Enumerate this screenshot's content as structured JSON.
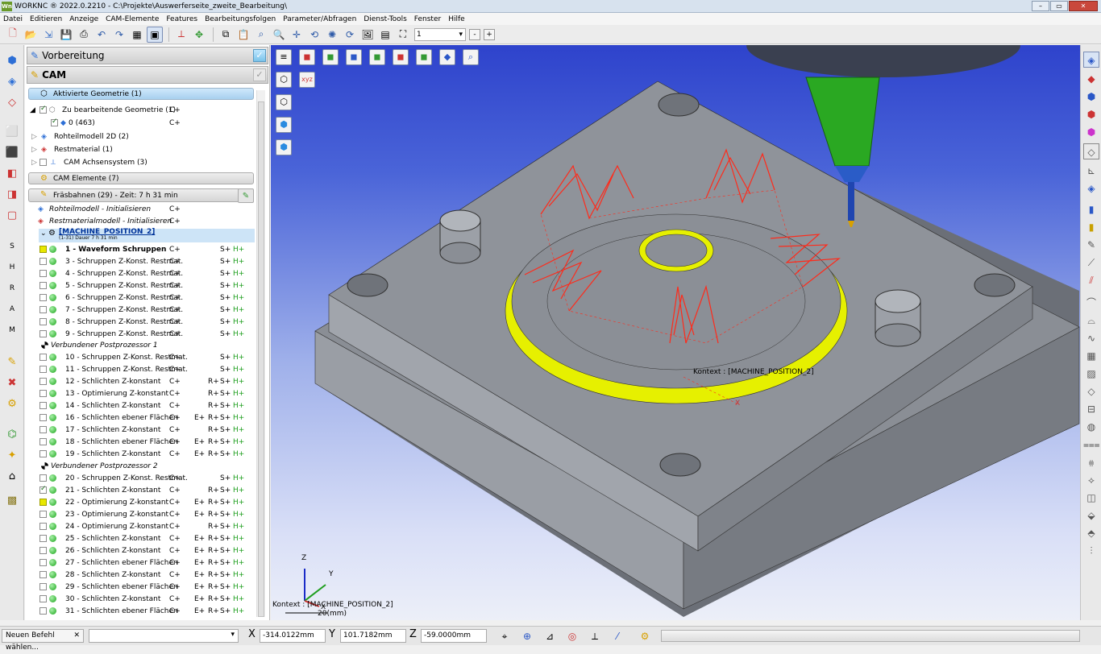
{
  "window": {
    "logo": "Wn",
    "title": "WORKNC ® 2022.0.2210 - C:\\Projekte\\Auswerferseite_zweite_Bearbeitung\\",
    "controls": [
      "–",
      "▭",
      "✕"
    ]
  },
  "menu": [
    "Datei",
    "Editieren",
    "Anzeige",
    "CAM-Elemente",
    "Features",
    "Bearbeitungsfolgen",
    "Parameter/Abfragen",
    "Dienst-Tools",
    "Fenster",
    "Hilfe"
  ],
  "toolbar": {
    "layer_value": "1",
    "minus": "-",
    "plus": "+"
  },
  "panel": {
    "header1": "Vorbereitung",
    "header2": "CAM",
    "group_active": "Aktivierte Geometrie (1)",
    "tree": [
      {
        "label": "Zu bearbeitende Geometrie (1)",
        "col": "C+"
      },
      {
        "label": "0 (463)",
        "col": "C+"
      },
      {
        "label": "Rohteilmodell 2D (2)",
        "col": ""
      },
      {
        "label": "Restmaterial (1)",
        "col": ""
      },
      {
        "label": "CAM Achsensystem (3)",
        "col": ""
      }
    ],
    "group_cam": "CAM Elemente (7)",
    "group_toolpaths": "Fräsbahnen (29) - Zeit: 7 h 31 min",
    "init_rows": [
      {
        "label": "Rohteilmodell - Initialisieren",
        "col": "C+"
      },
      {
        "label": "Restmaterialmodell - Initialisieren",
        "col": "C+"
      }
    ],
    "machine": {
      "label": "[MACHINE_POSITION_2]",
      "sub": "(1-31) Dauer 7 h 31 min"
    },
    "post1": "Verbundener Postprozessor 1",
    "post2": "Verbundener Postprozessor 2",
    "rows_a": [
      {
        "label": "1 - Waveform Schruppen",
        "c": "C+",
        "e": "",
        "r": "",
        "s": "S+",
        "h": "H+",
        "cb": "yellow",
        "bold": true
      },
      {
        "label": "3 - Schruppen Z-Konst. Restmat.",
        "c": "C+",
        "e": "",
        "r": "",
        "s": "S+",
        "h": "H+",
        "cb": ""
      },
      {
        "label": "4 - Schruppen Z-Konst. Restmat.",
        "c": "C+",
        "e": "",
        "r": "",
        "s": "S+",
        "h": "H+",
        "cb": ""
      },
      {
        "label": "5 - Schruppen Z-Konst. Restmat.",
        "c": "C+",
        "e": "",
        "r": "",
        "s": "S+",
        "h": "H+",
        "cb": ""
      },
      {
        "label": "6 - Schruppen Z-Konst. Restmat.",
        "c": "C+",
        "e": "",
        "r": "",
        "s": "S+",
        "h": "H+",
        "cb": ""
      },
      {
        "label": "7 - Schruppen Z-Konst. Restmat.",
        "c": "C+",
        "e": "",
        "r": "",
        "s": "S+",
        "h": "H+",
        "cb": ""
      },
      {
        "label": "8 - Schruppen Z-Konst. Restmat.",
        "c": "C+",
        "e": "",
        "r": "",
        "s": "S+",
        "h": "H+",
        "cb": ""
      },
      {
        "label": "9 - Schruppen Z-Konst. Restmat.",
        "c": "C+",
        "e": "",
        "r": "",
        "s": "S+",
        "h": "H+",
        "cb": ""
      }
    ],
    "rows_b": [
      {
        "label": "10 - Schruppen Z-Konst. Restmat.",
        "c": "C+",
        "e": "",
        "r": "",
        "s": "S+",
        "h": "H+",
        "cb": ""
      },
      {
        "label": "11 - Schruppen Z-Konst. Restmat.",
        "c": "C+",
        "e": "",
        "r": "",
        "s": "S+",
        "h": "H+",
        "cb": ""
      },
      {
        "label": "12 - Schlichten Z-konstant",
        "c": "C+",
        "e": "",
        "r": "R+",
        "s": "S+",
        "h": "H+",
        "cb": ""
      },
      {
        "label": "13 - Optimierung Z-konstant",
        "c": "C+",
        "e": "",
        "r": "R+",
        "s": "S+",
        "h": "H+",
        "cb": ""
      },
      {
        "label": "14 - Schlichten Z-konstant",
        "c": "C+",
        "e": "",
        "r": "R+",
        "s": "S+",
        "h": "H+",
        "cb": ""
      },
      {
        "label": "16 - Schlichten ebener Flächen",
        "c": "C+",
        "e": "E+",
        "r": "R+",
        "s": "S+",
        "h": "H+",
        "cb": ""
      },
      {
        "label": "17 - Schlichten Z-konstant",
        "c": "C+",
        "e": "",
        "r": "R+",
        "s": "S+",
        "h": "H+",
        "cb": ""
      },
      {
        "label": "18 - Schlichten ebener Flächen",
        "c": "C+",
        "e": "E+",
        "r": "R+",
        "s": "S+",
        "h": "H+",
        "cb": ""
      },
      {
        "label": "19 - Schlichten Z-konstant",
        "c": "C+",
        "e": "E+",
        "r": "R+",
        "s": "S+",
        "h": "H+",
        "cb": ""
      }
    ],
    "rows_c": [
      {
        "label": "20 - Schruppen Z-Konst. Restmat.",
        "c": "C+",
        "e": "",
        "r": "",
        "s": "S+",
        "h": "H+",
        "cb": ""
      },
      {
        "label": "21 - Schlichten Z-konstant",
        "c": "C+",
        "e": "",
        "r": "R+",
        "s": "S+",
        "h": "H+",
        "cb": "on"
      },
      {
        "label": "22 - Optimierung Z-konstant",
        "c": "C+",
        "e": "E+",
        "r": "R+",
        "s": "S+",
        "h": "H+",
        "cb": "yellow"
      },
      {
        "label": "23 - Optimierung Z-konstant",
        "c": "C+",
        "e": "E+",
        "r": "R+",
        "s": "S+",
        "h": "H+",
        "cb": ""
      },
      {
        "label": "24 - Optimierung Z-konstant",
        "c": "C+",
        "e": "",
        "r": "R+",
        "s": "S+",
        "h": "H+",
        "cb": ""
      },
      {
        "label": "25 - Schlichten Z-konstant",
        "c": "C+",
        "e": "E+",
        "r": "R+",
        "s": "S+",
        "h": "H+",
        "cb": ""
      },
      {
        "label": "26 - Schlichten Z-konstant",
        "c": "C+",
        "e": "E+",
        "r": "R+",
        "s": "S+",
        "h": "H+",
        "cb": ""
      },
      {
        "label": "27 - Schlichten ebener Flächen",
        "c": "C+",
        "e": "E+",
        "r": "R+",
        "s": "S+",
        "h": "H+",
        "cb": ""
      },
      {
        "label": "28 - Schlichten Z-konstant",
        "c": "C+",
        "e": "E+",
        "r": "R+",
        "s": "S+",
        "h": "H+",
        "cb": ""
      },
      {
        "label": "29 - Schlichten ebener Flächen",
        "c": "C+",
        "e": "E+",
        "r": "R+",
        "s": "S+",
        "h": "H+",
        "cb": ""
      },
      {
        "label": "30 - Schlichten Z-konstant",
        "c": "C+",
        "e": "E+",
        "r": "R+",
        "s": "S+",
        "h": "H+",
        "cb": ""
      },
      {
        "label": "31 - Schlichten ebener Flächen",
        "c": "C+",
        "e": "E+",
        "r": "R+",
        "s": "S+",
        "h": "H+",
        "cb": ""
      }
    ]
  },
  "viewport": {
    "context_label": "Kontext : [MACHINE_POSITION_2]",
    "context_label_bottom": "Kontext : [MACHINE_POSITION_2]",
    "scale_label": "20(mm)",
    "triad": {
      "x": "X",
      "y": "Y",
      "z": "Z"
    },
    "axis_x": "X",
    "colors": {
      "part": "#8d9197",
      "toolpath": "#ff2a1a",
      "ring": "#e6f000",
      "tool": "#2aa822",
      "background_top": "#2e43cc"
    }
  },
  "statusbar": {
    "command": "Neuen Befehl wählen...",
    "close": "✕",
    "x_label": "X",
    "x_value": "-314.0122mm",
    "y_label": "Y",
    "y_value": "101.7182mm",
    "z_label": "Z",
    "z_value": "-59.0000mm"
  }
}
